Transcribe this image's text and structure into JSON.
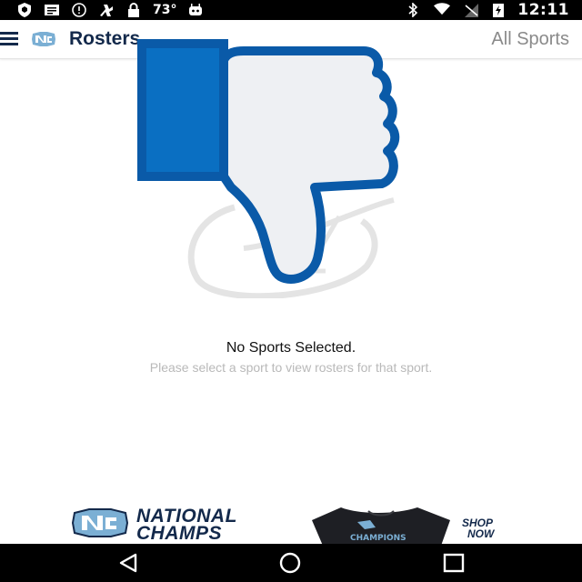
{
  "status_bar": {
    "icons_left": [
      "shield-icon",
      "message-icon",
      "alert-icon",
      "fan-icon",
      "lock-icon",
      "android-icon"
    ],
    "temperature": "73°",
    "icons_right": [
      "bluetooth-icon",
      "wifi-icon",
      "no-signal-icon",
      "battery-icon"
    ],
    "time": "12:11"
  },
  "app_bar": {
    "menu_icon": "hamburger-icon",
    "logo_icon": "nc-logo-icon",
    "title": "Rosters",
    "filter_label": "All Sports"
  },
  "overlay": {
    "icon": "thumbs-down-icon",
    "colors": {
      "cuff": "#0a6fc2",
      "outline": "#0a5aa8",
      "fill": "#eef0f3"
    }
  },
  "empty_state": {
    "title": "No Sports Selected.",
    "subtitle": "Please select a sport to view rosters for that sport."
  },
  "banner": {
    "line1": "NATIONAL",
    "line2": "CHAMPS",
    "shirt_text": "CHAMPIONS",
    "shop_line1": "SHOP",
    "shop_line2": "NOW",
    "colors": {
      "navy": "#13294b",
      "carolina_blue": "#7bafd4"
    }
  },
  "nav_bar": {
    "buttons": [
      "back-icon",
      "home-icon",
      "recents-icon"
    ]
  }
}
